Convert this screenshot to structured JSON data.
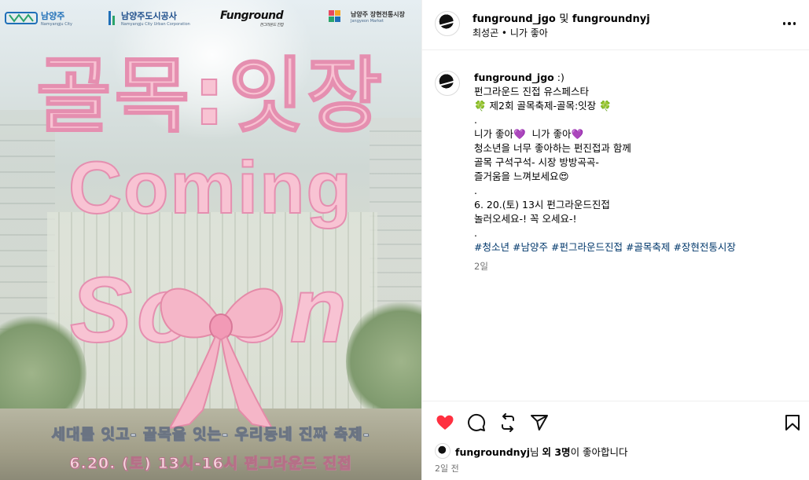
{
  "poster": {
    "logos": [
      "남양주",
      "남양주도시공사",
      "Funground",
      "남양주 장현전통시장"
    ],
    "logo_subs": [
      "Namyangju City",
      "Namyangju City Urban Corporation",
      "펀그라운드 진접",
      "Jangyeon Market"
    ],
    "title_korean": "골목:잇장",
    "coming": "Coming",
    "soon": "So  on",
    "tagline": "세대를 잇고- 골목을 잇는- 우리동네 진짜 축제-",
    "date_line": "6.20. (토) 13시-16시 펀그라운드 진접"
  },
  "header": {
    "user1": "funground_jgo",
    "and": "및",
    "user2": "fungroundnyj",
    "sub": "최성곤 • 니가 좋아"
  },
  "caption": {
    "username": "funground_jgo",
    "lines": [
      ":)",
      "펀그라운드 진접 유스페스타",
      "🍀 제2회 골목축제-골목:잇장 🍀",
      ".",
      "니가 좋아💜  니가 좋아💜",
      "청소년을 너무 좋아하는 펀진접과 함께",
      "골목 구석구석- 시장 방방곡곡-",
      "즐거움을 느껴보세요😍",
      ".",
      "6. 20.(토) 13시 펀그라운드진접",
      "놀러오세요-! 꼭 오세요-!",
      "."
    ],
    "hashtags": [
      "#청소년",
      "#남양주",
      "#펀그라운드진접",
      "#골목축제",
      "#장현전통시장"
    ],
    "time": "2일"
  },
  "likes": {
    "user": "fungroundnyj",
    "suffix1": "님 ",
    "others": "외 3명",
    "suffix2": "이 좋아합니다"
  },
  "post_time": "2일 전",
  "icons": [
    "heart-icon",
    "comment-icon",
    "share-icon",
    "send-icon",
    "bookmark-icon",
    "more-icon"
  ],
  "colors": {
    "like_red": "#ff3040",
    "hashtag_blue": "#00376b",
    "poster_pink": "#f8c3d3"
  }
}
